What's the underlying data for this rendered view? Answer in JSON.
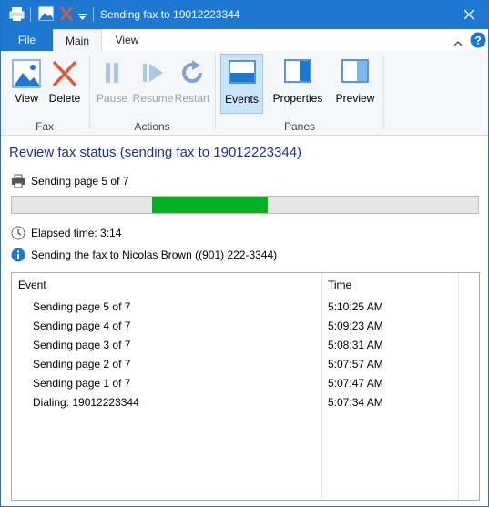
{
  "window": {
    "title": "Sending fax to 19012223344"
  },
  "tabs": [
    {
      "label": "File"
    },
    {
      "label": "Main"
    },
    {
      "label": "View"
    }
  ],
  "ribbon": {
    "buttons": [
      {
        "label": "View",
        "icon": "image-icon",
        "enabled": true
      },
      {
        "label": "Delete",
        "icon": "delete-x-icon",
        "enabled": true
      },
      {
        "label": "Pause",
        "icon": "pause-icon",
        "enabled": false
      },
      {
        "label": "Resume",
        "icon": "resume-icon",
        "enabled": false
      },
      {
        "label": "Restart",
        "icon": "restart-icon",
        "enabled": false
      },
      {
        "label": "Events",
        "icon": "events-pane-icon",
        "enabled": true,
        "selected": true
      },
      {
        "label": "Properties",
        "icon": "properties-pane-icon",
        "enabled": true
      },
      {
        "label": "Preview",
        "icon": "preview-pane-icon",
        "enabled": true
      }
    ],
    "groups": [
      {
        "label": "Fax"
      },
      {
        "label": "Actions"
      },
      {
        "label": "Panes"
      }
    ]
  },
  "status": {
    "heading": "Review fax status (sending fax to 19012223344)",
    "page_progress": "Sending page 5 of 7",
    "elapsed": "Elapsed time: 3:14",
    "recipient": "Sending the fax to Nicolas Brown ((901) 222-3344)",
    "progress_color": "#06b025"
  },
  "events": {
    "columns": [
      "Event",
      "Time"
    ],
    "rows": [
      {
        "event": "Sending page 5 of 7",
        "time": "5:10:25 AM"
      },
      {
        "event": "Sending page 4 of 7",
        "time": "5:09:23 AM"
      },
      {
        "event": "Sending page 3 of 7",
        "time": "5:08:31 AM"
      },
      {
        "event": "Sending page 2 of 7",
        "time": "5:07:57 AM"
      },
      {
        "event": "Sending page 1 of 7",
        "time": "5:07:47 AM"
      },
      {
        "event": "Dialing: 19012223344",
        "time": "5:07:34 AM"
      }
    ]
  },
  "colors": {
    "accent": "#1e78d2",
    "heading": "#1e3287"
  }
}
